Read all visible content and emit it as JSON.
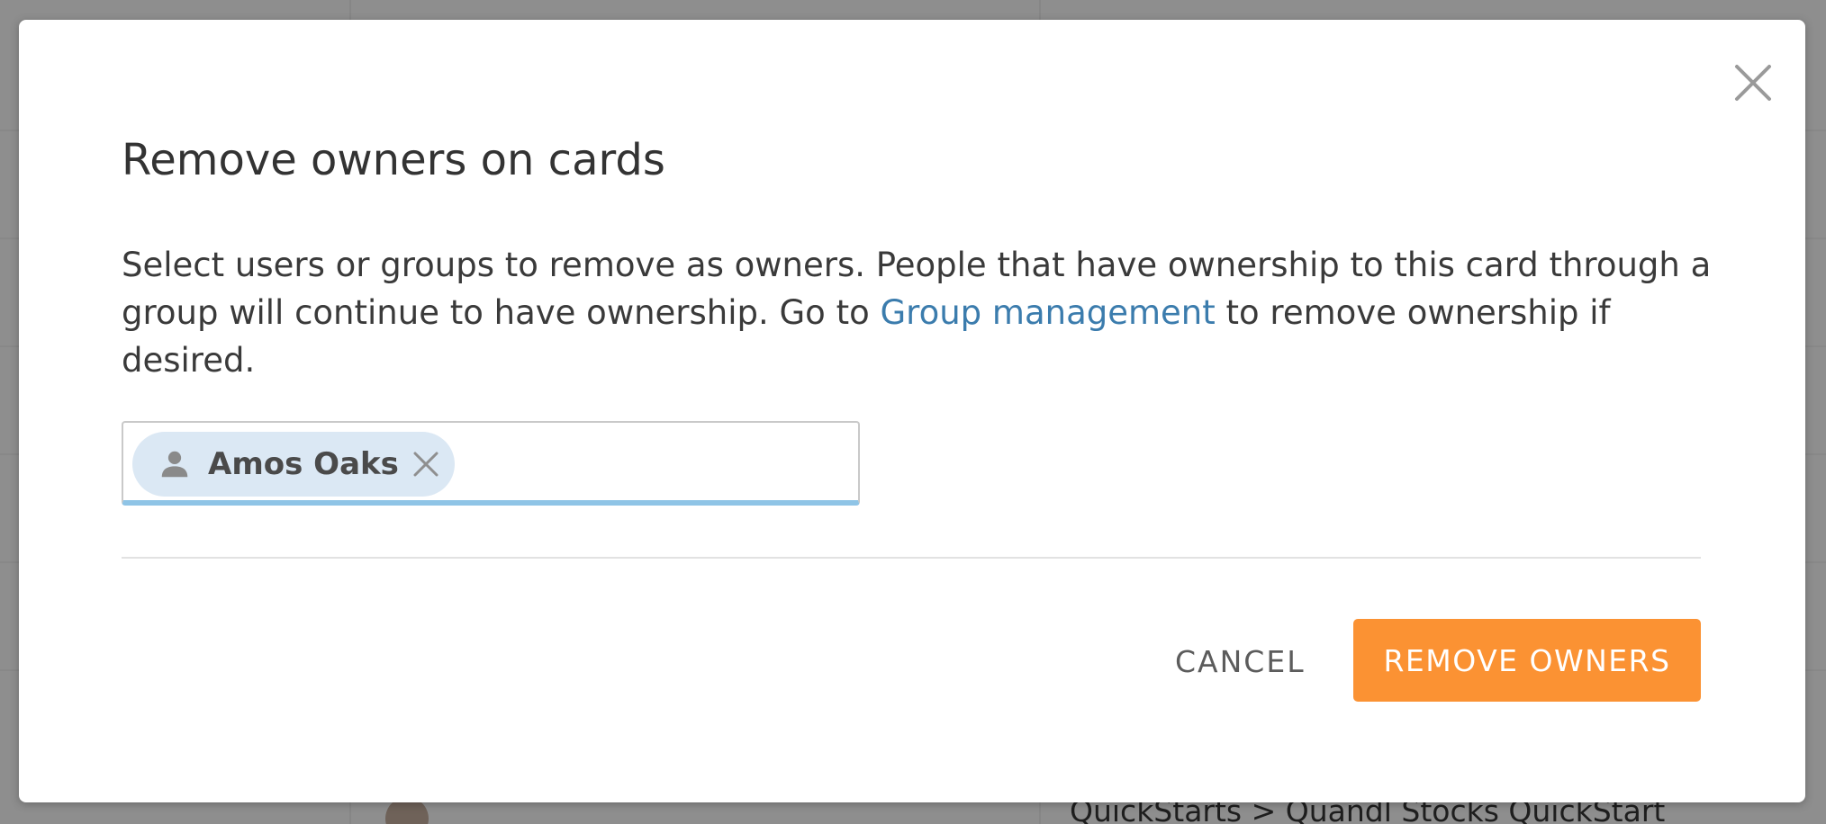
{
  "background": {
    "breadcrumb": "QuickStarts > Quandl Stocks QuickStart"
  },
  "modal": {
    "title": "Remove owners on cards",
    "description_before_link": "Select users or groups to remove as owners. People that have ownership to this card through a group will continue to have ownership. Go to ",
    "link_text": "Group management",
    "description_after_link": " to remove ownership if desired.",
    "selected_owners": [
      {
        "name": "Amos Oaks",
        "icon": "user-icon"
      }
    ],
    "cancel_label": "CANCEL",
    "confirm_label": "REMOVE OWNERS",
    "close_icon": "close-icon"
  },
  "colors": {
    "overlay": "#8f8f8f",
    "link": "#3b7cad",
    "chip_background": "#dbe8f4",
    "field_focus_underline": "#8fc4e6",
    "primary_button": "#fb9233"
  }
}
